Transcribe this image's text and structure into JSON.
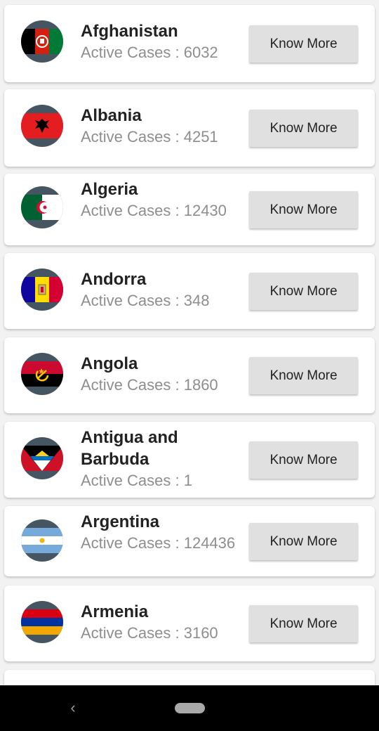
{
  "countries": [
    {
      "name": "Afghanistan",
      "active_label": "Active Cases : 6032",
      "button": "Know More",
      "flag_icon": "afghanistan-flag-icon"
    },
    {
      "name": "Albania",
      "active_label": "Active Cases : 4251",
      "button": "Know More",
      "flag_icon": "albania-flag-icon"
    },
    {
      "name": "Algeria",
      "active_label": "Active Cases : 12430",
      "button": "Know More",
      "flag_icon": "algeria-flag-icon"
    },
    {
      "name": "Andorra",
      "active_label": "Active Cases : 348",
      "button": "Know More",
      "flag_icon": "andorra-flag-icon"
    },
    {
      "name": "Angola",
      "active_label": "Active Cases : 1860",
      "button": "Know More",
      "flag_icon": "angola-flag-icon"
    },
    {
      "name": "Antigua and Barbuda",
      "active_label": "Active Cases : 1",
      "button": "Know More",
      "flag_icon": "antigua-and-barbuda-flag-icon"
    },
    {
      "name": "Argentina",
      "active_label": "Active Cases : 124436",
      "button": "Know More",
      "flag_icon": "argentina-flag-icon"
    },
    {
      "name": "Armenia",
      "active_label": "Active Cases : 3160",
      "button": "Know More",
      "flag_icon": "armenia-flag-icon"
    }
  ],
  "navbar": {
    "back_icon": "back-chevron-icon",
    "home_icon": "home-pill-icon"
  },
  "colors": {
    "card": "#ffffff",
    "background": "#f2f2f2",
    "button": "#e0e0e0",
    "muted_text": "#8e8e8e",
    "flag_circle": "#455561"
  }
}
